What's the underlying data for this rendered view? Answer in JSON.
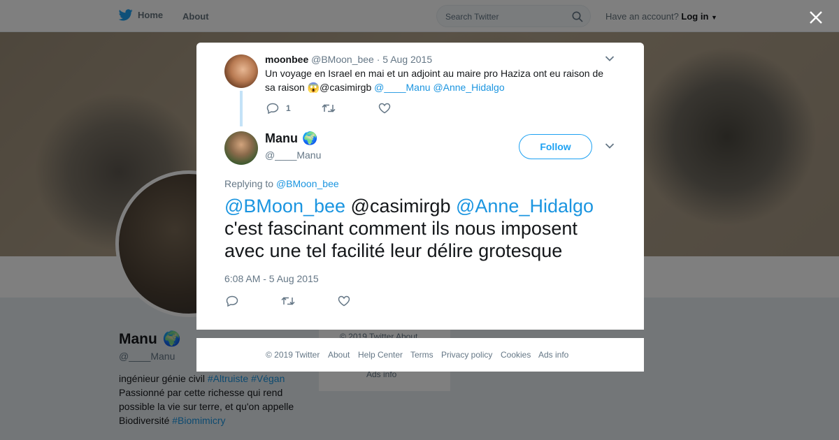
{
  "nav": {
    "home_label": "Home",
    "about_label": "About",
    "search_placeholder": "Search Twitter",
    "have_account": "Have an account?",
    "login_label": "Log in"
  },
  "profile": {
    "name": "Manu",
    "name_emoji": "🌍",
    "handle": "@____Manu",
    "bio_line1_text": "ingénieur génie civil ",
    "bio_tag1": "#Altruiste",
    "bio_tag2": "#Végan",
    "bio_middle": "Passionné par cette richesse qui rend possible la vie sur terre, et qu'on appelle Biodiversité ",
    "bio_tag3": "#Biomimicry"
  },
  "side_card": {
    "line1": "© 2019 Twitter   About",
    "line2": "Ads info"
  },
  "parent_tweet": {
    "name": "moonbee",
    "handle": "@BMoon_bee",
    "date": "· 5 Aug 2015",
    "text_main": "Un voyage en Israel en mai et un adjoint au maire pro Haziza  ont eu raison de sa raison ",
    "emoji": "😱",
    "plain_mention": "@casimirgb ",
    "link_mention1": "@____Manu",
    "link_mention2": "@Anne_Hidalgo",
    "reply_count": "1"
  },
  "main_tweet": {
    "name": "Manu",
    "name_emoji": "🌍",
    "handle": "@____Manu",
    "follow_label": "Follow",
    "replying_to_label": "Replying to ",
    "replying_to_handle": "@BMoon_bee",
    "mention1": "@BMoon_bee",
    "plain_mention": " @casimirgb ",
    "mention2": "@Anne_Hidalgo",
    "text_body": "c'est fascinant comment ils nous imposent avec une tel facilité leur délire grotesque",
    "timestamp": "6:08 AM - 5 Aug 2015"
  },
  "footer": {
    "copyright": "© 2019 Twitter",
    "about": "About",
    "help": "Help Center",
    "terms": "Terms",
    "privacy": "Privacy policy",
    "cookies": "Cookies",
    "ads": "Ads info"
  },
  "colors": {
    "brand_blue": "#1da1f2",
    "link_blue": "#1b95e0",
    "muted_gray": "#657786"
  }
}
